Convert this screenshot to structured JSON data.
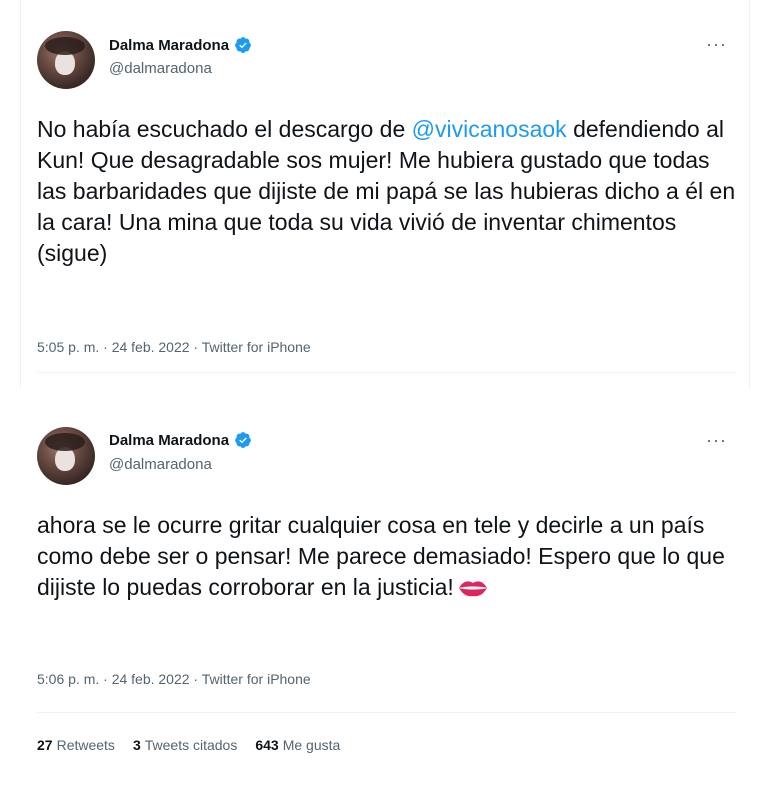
{
  "tweets": [
    {
      "display_name": "Dalma Maradona",
      "handle": "@dalmaradona",
      "more_label": "···",
      "text_before": "No había escuchado el descargo de ",
      "mention": "@vivicanosaok",
      "text_after": " defendiendo al Kun! Que desagradable sos mujer! Me hubiera gustado que todas las barbaridades que dijiste de mi papá se las hubieras dicho a él en la cara! Una mina que toda su vida vivió de inventar chimentos (sigue)",
      "meta": "5:05 p. m. · 24 feb. 2022 · Twitter for iPhone"
    },
    {
      "display_name": "Dalma Maradona",
      "handle": "@dalmaradona",
      "more_label": "···",
      "text": "ahora se le ocurre gritar cualquier cosa en tele y decirle a un país como debe ser o pensar! Me parece demasiado! Espero que lo que dijiste lo puedas corroborar en la justicia!",
      "emoji": "kiss-mark-icon",
      "meta": "5:06 p. m. · 24 feb. 2022 · Twitter for iPhone"
    }
  ],
  "stats": {
    "retweets_count": "27",
    "retweets_label": "Retweets",
    "quotes_count": "3",
    "quotes_label": "Tweets citados",
    "likes_count": "643",
    "likes_label": "Me gusta"
  },
  "colors": {
    "accent": "#1d9bf0",
    "text": "#0f1419",
    "secondary": "#536471",
    "emoji_red": "#e0245e"
  }
}
